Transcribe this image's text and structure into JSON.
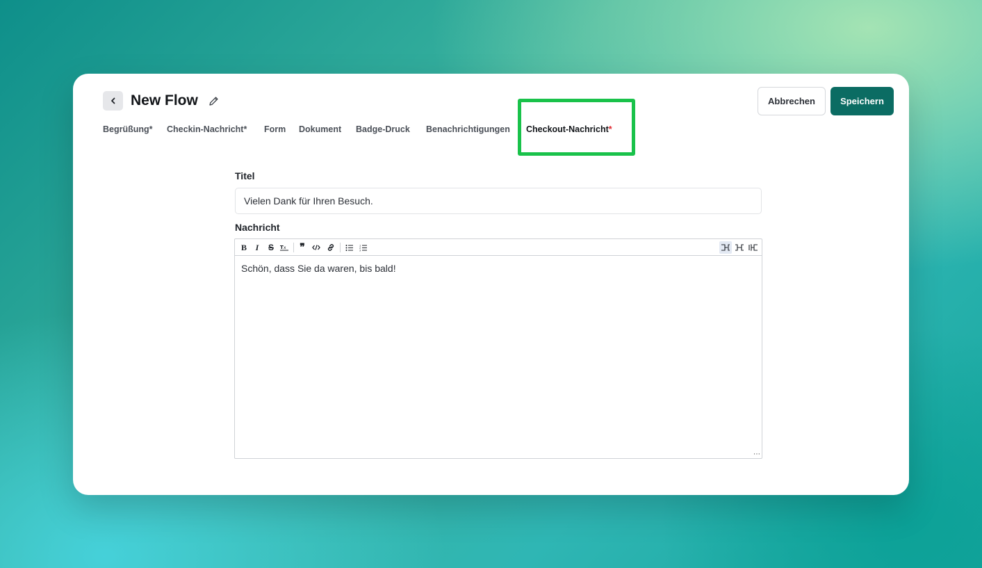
{
  "header": {
    "title": "New Flow",
    "cancel_label": "Abbrechen",
    "save_label": "Speichern"
  },
  "tabs": [
    {
      "label": "Begrüßung",
      "required": "*"
    },
    {
      "label": "Checkin-Nachricht",
      "required": "*"
    },
    {
      "label": "Form",
      "required": ""
    },
    {
      "label": "Dokument",
      "required": ""
    },
    {
      "label": "Badge-Druck",
      "required": ""
    },
    {
      "label": "Benachrichtigungen",
      "required": ""
    },
    {
      "label": "Checkout-Nachricht",
      "required": "*",
      "active": true
    }
  ],
  "form": {
    "title_label": "Titel",
    "title_value": "Vielen Dank für Ihren Besuch.",
    "message_label": "Nachricht",
    "message_value": "Schön, dass Sie da waren, bis bald!"
  },
  "icons": {
    "back": "chevron-left-icon",
    "edit": "pencil-icon",
    "toolbar": [
      "bold-icon",
      "italic-icon",
      "strikethrough-icon",
      "clear-format-icon",
      "quote-icon",
      "code-icon",
      "link-icon",
      "bullet-list-icon",
      "numbered-list-icon",
      "width-narrow-icon",
      "width-medium-icon",
      "width-wide-icon"
    ]
  },
  "colors": {
    "primary": "#0b6c63",
    "highlight": "#19c24a",
    "required": "#e0282f"
  }
}
